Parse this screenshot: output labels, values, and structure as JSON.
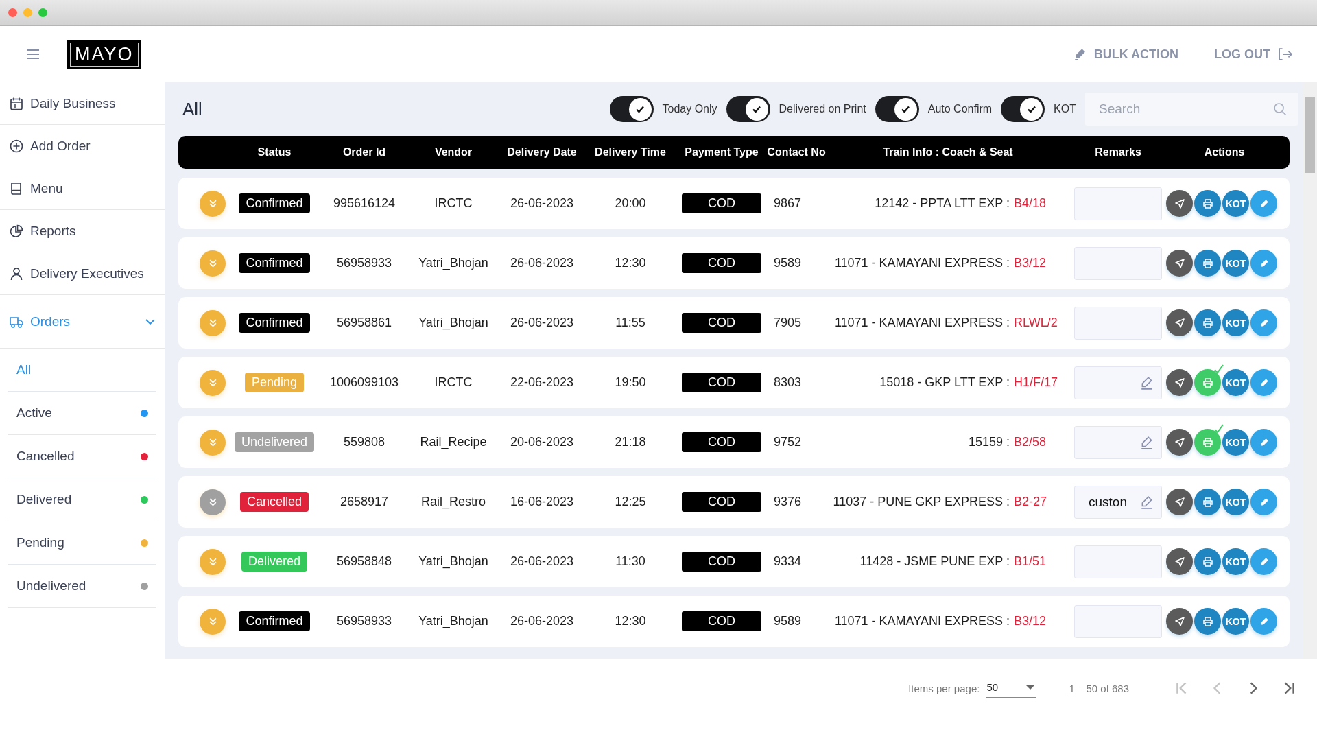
{
  "header": {
    "logo": "MAYO",
    "bulk_action": "BULK ACTION",
    "logout": "LOG OUT"
  },
  "sidebar": {
    "items": [
      {
        "label": "Daily Business",
        "selected": false
      },
      {
        "label": "Add Order",
        "selected": false
      },
      {
        "label": "Menu",
        "selected": false
      },
      {
        "label": "Reports",
        "selected": false
      },
      {
        "label": "Delivery Executives",
        "selected": false
      },
      {
        "label": "Orders",
        "selected": true,
        "expanded": true,
        "children": [
          {
            "label": "All",
            "selected": true
          },
          {
            "label": "Active",
            "selected": false,
            "color": "#2196f3"
          },
          {
            "label": "Cancelled",
            "selected": false,
            "color": "#e5223b"
          },
          {
            "label": "Delivered",
            "selected": false,
            "color": "#2ec95c"
          },
          {
            "label": "Pending",
            "selected": false,
            "color": "#f0b43c"
          },
          {
            "label": "Undelivered",
            "selected": false,
            "color": "#a0a0a0"
          }
        ]
      }
    ]
  },
  "page_title": "All",
  "toggles": [
    {
      "label": "Today Only",
      "on": true
    },
    {
      "label": "Delivered on Print",
      "on": true
    },
    {
      "label": "Auto Confirm",
      "on": true
    },
    {
      "label": "KOT",
      "on": true
    }
  ],
  "search": {
    "placeholder": "Search"
  },
  "table": {
    "columns": [
      "Status",
      "Order Id",
      "Vendor",
      "Delivery Date",
      "Delivery Time",
      "Payment Type",
      "Contact No",
      "Train Info : Coach & Seat",
      "Remarks",
      "Actions"
    ],
    "rows": [
      {
        "status": "Confirmed",
        "kind": "confirmed",
        "order_id": "995616124",
        "vendor": "IRCTC",
        "date": "26-06-2023",
        "time": "20:00",
        "payment": "COD",
        "contact": "9867",
        "train": "12142 - PPTA LTT EXP :",
        "seat": "B4/18",
        "remarks": "",
        "remarks_editable": false,
        "printed": false,
        "kot": "KOT"
      },
      {
        "status": "Confirmed",
        "kind": "confirmed",
        "order_id": "56958933",
        "vendor": "Yatri_Bhojan",
        "date": "26-06-2023",
        "time": "12:30",
        "payment": "COD",
        "contact": "9589",
        "train": "11071 - KAMAYANI EXPRESS :",
        "seat": "B3/12",
        "remarks": "",
        "remarks_editable": false,
        "printed": false,
        "kot": "KOT"
      },
      {
        "status": "Confirmed",
        "kind": "confirmed",
        "order_id": "56958861",
        "vendor": "Yatri_Bhojan",
        "date": "26-06-2023",
        "time": "11:55",
        "payment": "COD",
        "contact": "7905",
        "train": "11071 - KAMAYANI EXPRESS :",
        "seat": "RLWL/2",
        "remarks": "",
        "remarks_editable": false,
        "printed": false,
        "kot": "KOT"
      },
      {
        "status": "Pending",
        "kind": "pending",
        "order_id": "1006099103",
        "vendor": "IRCTC",
        "date": "22-06-2023",
        "time": "19:50",
        "payment": "COD",
        "contact": "8303",
        "train": "15018 - GKP LTT EXP :",
        "seat": "H1/F/17",
        "remarks": "",
        "remarks_editable": true,
        "printed": true,
        "kot": "KOT"
      },
      {
        "status": "Undelivered",
        "kind": "undelivered",
        "order_id": "559808",
        "vendor": "Rail_Recipe",
        "date": "20-06-2023",
        "time": "21:18",
        "payment": "COD",
        "contact": "9752",
        "train": "15159 :",
        "seat": "B2/58",
        "remarks": "",
        "remarks_editable": true,
        "printed": true,
        "kot": "KOT"
      },
      {
        "status": "Cancelled",
        "kind": "cancelled",
        "order_id": "2658917",
        "vendor": "Rail_Restro",
        "date": "16-06-2023",
        "time": "12:25",
        "payment": "COD",
        "contact": "9376",
        "train": "11037 - PUNE GKP EXPRESS :",
        "seat": "B2-27",
        "remarks": "custon",
        "remarks_editable": true,
        "printed": false,
        "kot": "KOT"
      },
      {
        "status": "Delivered",
        "kind": "delivered",
        "order_id": "56958848",
        "vendor": "Yatri_Bhojan",
        "date": "26-06-2023",
        "time": "11:30",
        "payment": "COD",
        "contact": "9334",
        "train": "11428 - JSME PUNE EXP :",
        "seat": "B1/51",
        "remarks": "",
        "remarks_editable": false,
        "printed": false,
        "kot": "KOT"
      },
      {
        "status": "Confirmed",
        "kind": "confirmed",
        "order_id": "56958933",
        "vendor": "Yatri_Bhojan",
        "date": "26-06-2023",
        "time": "12:30",
        "payment": "COD",
        "contact": "9589",
        "train": "11071 - KAMAYANI EXPRESS :",
        "seat": "B3/12",
        "remarks": "",
        "remarks_editable": false,
        "printed": false,
        "kot": "KOT"
      }
    ]
  },
  "pagination": {
    "label": "Items per page:",
    "page_size": "50",
    "range": "1 – 50 of 683",
    "first_disabled": true,
    "prev_disabled": true,
    "next_disabled": false,
    "last_disabled": false
  }
}
